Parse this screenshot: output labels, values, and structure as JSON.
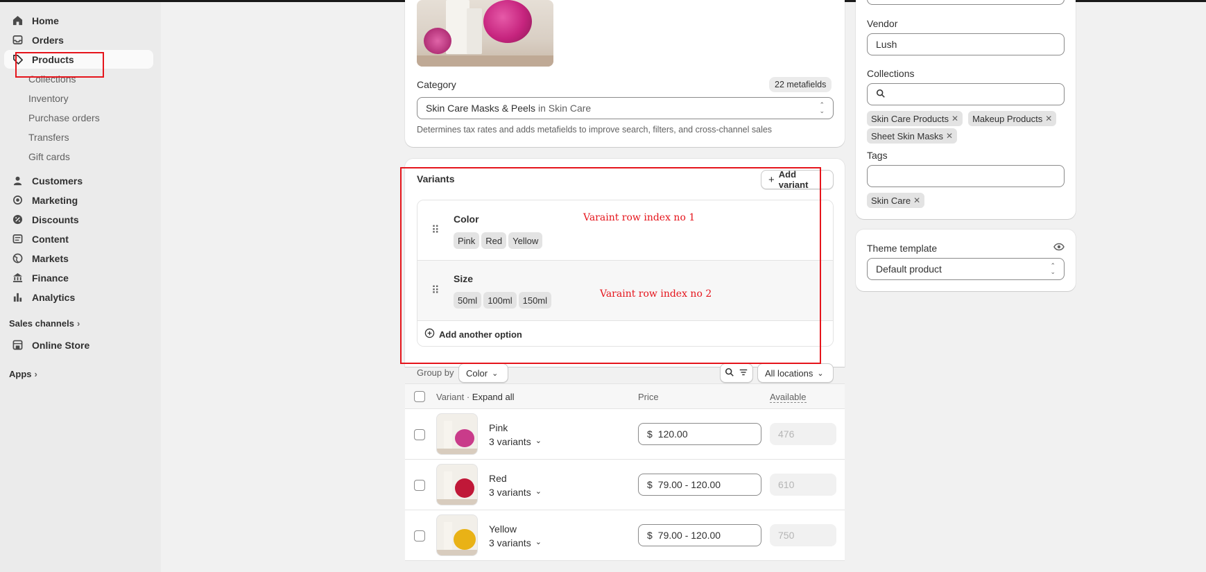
{
  "sidebar": {
    "home": "Home",
    "orders": "Orders",
    "products": "Products",
    "collections": "Collections",
    "inventory": "Inventory",
    "purchase_orders": "Purchase orders",
    "transfers": "Transfers",
    "gift_cards": "Gift cards",
    "customers": "Customers",
    "marketing": "Marketing",
    "discounts": "Discounts",
    "content": "Content",
    "markets": "Markets",
    "finance": "Finance",
    "analytics": "Analytics",
    "sales_channels": "Sales channels",
    "online_store": "Online Store",
    "apps": "Apps"
  },
  "category": {
    "label": "Category",
    "metafields_badge": "22 metafields",
    "value_main": "Skin Care Masks & Peels",
    "value_suffix": "in Skin Care",
    "help": "Determines tax rates and adds metafields to improve search, filters, and cross-channel sales"
  },
  "variants": {
    "title": "Variants",
    "add_variant": "Add variant",
    "options": [
      {
        "name": "Color",
        "values": [
          "Pink",
          "Red",
          "Yellow"
        ]
      },
      {
        "name": "Size",
        "values": [
          "50ml",
          "100ml",
          "150ml"
        ]
      }
    ],
    "add_option": "Add another option",
    "group_by_label": "Group by",
    "group_by_value": "Color",
    "locations": "All locations",
    "col_variant": "Variant",
    "col_expand": "Expand all",
    "col_price": "Price",
    "col_available": "Available",
    "rows": [
      {
        "name": "Pink",
        "sub": "3 variants",
        "currency": "$",
        "price": "120.00",
        "available": "476"
      },
      {
        "name": "Red",
        "sub": "3 variants",
        "currency": "$",
        "price": "79.00 - 120.00",
        "available": "610"
      },
      {
        "name": "Yellow",
        "sub": "3 variants",
        "currency": "$",
        "price": "79.00 - 120.00",
        "available": "750"
      }
    ]
  },
  "right": {
    "vendor_label": "Vendor",
    "vendor_value": "Lush",
    "collections_label": "Collections",
    "collections_chips": [
      "Skin Care Products",
      "Makeup Products",
      "Sheet Skin Masks"
    ],
    "tags_label": "Tags",
    "tags_chips": [
      "Skin Care"
    ],
    "theme_label": "Theme template",
    "theme_value": "Default product"
  },
  "annotations": {
    "row1": "Varaint row index no 1",
    "row2": "Varaint row index no 2"
  },
  "colors": {
    "annotation": "#e5141b",
    "sidebar_bg": "#ebebeb",
    "page_bg": "#f1f1f1"
  }
}
